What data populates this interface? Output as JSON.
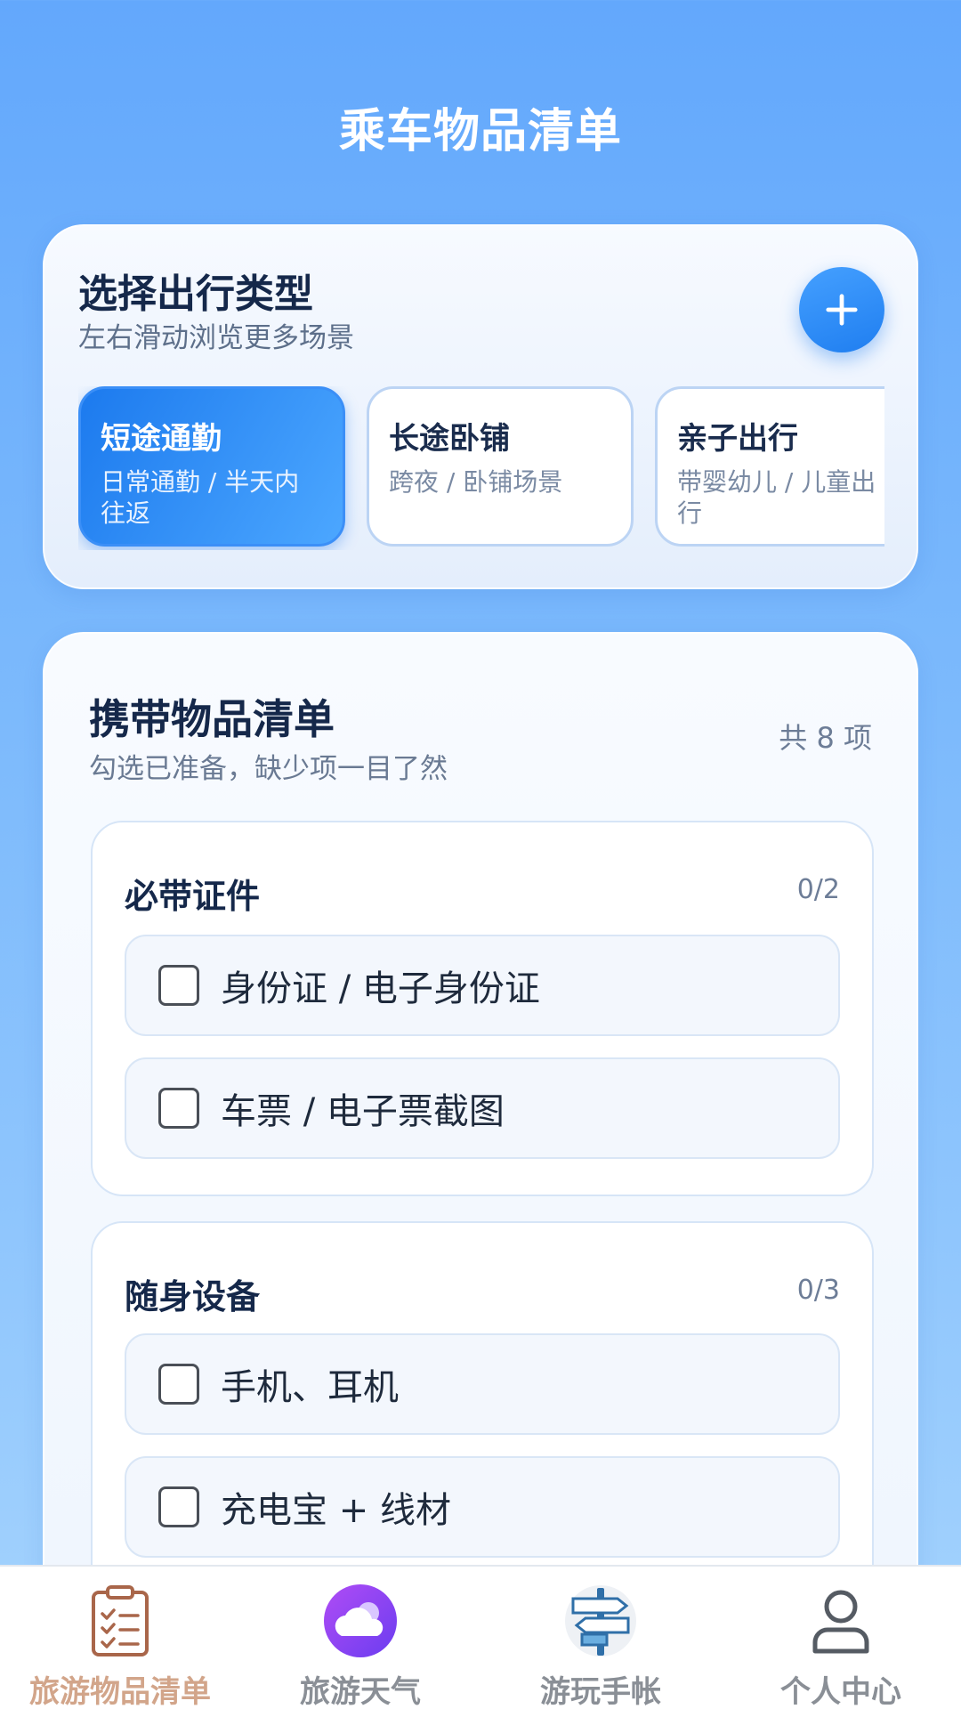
{
  "page_title": "乘车物品清单",
  "trip_type": {
    "title": "选择出行类型",
    "subtitle": "左右滑动浏览更多场景",
    "add_label": "+",
    "items": [
      {
        "name": "短途通勤",
        "desc": "日常通勤 / 半天内往返",
        "active": true
      },
      {
        "name": "长途卧铺",
        "desc": "跨夜 / 卧铺场景",
        "active": false
      },
      {
        "name": "亲子出行",
        "desc": "带婴幼儿 / 儿童出行",
        "active": false
      }
    ]
  },
  "checklist": {
    "title": "携带物品清单",
    "subtitle": "勾选已准备，缺少项一目了然",
    "count": "共 8 项",
    "groups": [
      {
        "title": "必带证件",
        "progress": "0/2",
        "items": [
          {
            "label": "身份证 / 电子身份证",
            "checked": false
          },
          {
            "label": "车票 / 电子票截图",
            "checked": false
          }
        ]
      },
      {
        "title": "随身设备",
        "progress": "0/3",
        "items": [
          {
            "label": "手机、耳机",
            "checked": false
          },
          {
            "label": "充电宝 + 线材",
            "checked": false
          }
        ]
      }
    ]
  },
  "tabbar": {
    "tabs": [
      {
        "label": "旅游物品清单",
        "icon": "clipboard-checklist-icon",
        "active": true
      },
      {
        "label": "旅游天气",
        "icon": "cloud-icon",
        "active": false
      },
      {
        "label": "游玩手帐",
        "icon": "signpost-icon",
        "active": false
      },
      {
        "label": "个人中心",
        "icon": "user-icon",
        "active": false
      }
    ]
  },
  "colors": {
    "accent": "#1f7ef0",
    "active_tab": "#d2a58a",
    "background_top": "#63a8fc"
  }
}
